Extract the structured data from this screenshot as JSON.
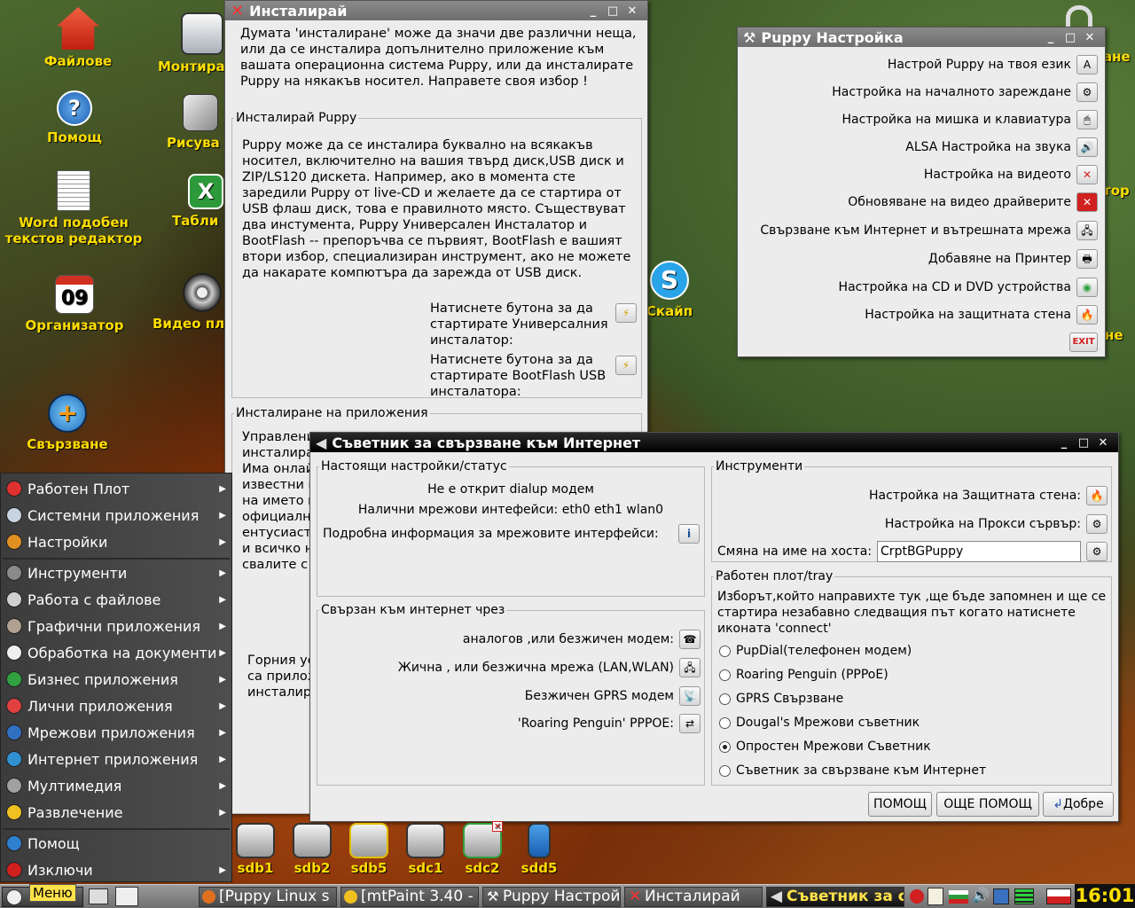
{
  "desktop_icons": [
    {
      "label": "Файлове",
      "color": "#e0402a"
    },
    {
      "label": "Монтира",
      "color": "#dfe6ee"
    },
    {
      "label": "Помощ",
      "color": "#2f7ed8"
    },
    {
      "label": "Рисува",
      "color": "#8a8f99"
    },
    {
      "label": "Word подобен текстов редактор",
      "color": "#f4f4f4"
    },
    {
      "label": "Табли",
      "color": "#2c9a3a"
    },
    {
      "label": "Организатор",
      "color": "#e8e8e8"
    },
    {
      "label": "Видео пл",
      "color": "#bdbdbd"
    },
    {
      "label": "Свързване",
      "color": "#2f9ae0"
    },
    {
      "label": "Скайп",
      "color": "#2aa4e8"
    },
    {
      "label": "ане"
    },
    {
      "label": "тор"
    },
    {
      "label": "не"
    }
  ],
  "installer": {
    "title": "Инсталирай",
    "intro": "Думата 'инсталиране' може да значи две различни неща, или да се инсталира допълнително приложение към вашата операционна система Puppy, или да инсталирате Puppy на някакъв носител. Направете своя избор !",
    "puppy_legend": "Инсталирай Puppy",
    "puppy_text": "Puppy може да се инсталира буквално на всякакъв носител, включително на вашия твърд диск,USB диск и ZIP/LS120 дискета. Например, ако в момента сте заредили Puppy от live-CD и  желаете да се стартира от USB флаш диск, това е правилното място. Съществуват два инстумента, Puppy Универсален Инсталатор и BootFlash -- препоръчва се първият, BootFlash е вашият втори избор, специализиран инструмент, ако не можете да накарате компютъра да зарежда от USB диск.",
    "universal_label": "Натиснете бутона за да стартирате Универсалния инсталатор:",
    "bootflash_label": "Натиснете бутона за да стартирате BootFlash USB инсталатора:",
    "apps_legend": "Инсталиране на приложения",
    "apps_lines": [
      "Управлени",
      "инсталира",
      "Има онлай",
      "известни п",
      "на името н",
      "официално",
      "ентусиасти",
      "и всичко н",
      "свалите с"
    ],
    "bottom_lines": [
      "Горния уе",
      "са прилож",
      "инсталир"
    ]
  },
  "settings": {
    "title": "Puppy Настройка",
    "items": [
      {
        "label": "Настрой Puppy на твоя език",
        "icon": "A"
      },
      {
        "label": "Настройка на началното зареждане",
        "icon": "⚙"
      },
      {
        "label": "Настройка на мишка и клавиатура",
        "icon": "🖱"
      },
      {
        "label": "ALSA Настройка на звука",
        "icon": "🔊"
      },
      {
        "label": "Настройка на видеото",
        "icon": "✕"
      },
      {
        "label": "Обновяване на видео драйверите",
        "icon": "✕"
      },
      {
        "label": "Свързване към Интернет и вътрешната мрежа",
        "icon": "🖧"
      },
      {
        "label": "Добавяне на Принтер",
        "icon": "🖶"
      },
      {
        "label": "Настройка на CD и DVD устройства",
        "icon": "◉"
      },
      {
        "label": "Настройка на защитната стена",
        "icon": "🔥"
      }
    ],
    "exit_label": "EXIT"
  },
  "wizard": {
    "title": "Съветник за свързване към Интернет",
    "status_legend": "Настоящи настройки/статус",
    "status_line1": "Не е открит dialup модем",
    "status_line2": "Налични мрежови интефейси: eth0 eth1 wlan0",
    "status_detail": "Подробна информация за мрежовите интерфейси:",
    "connect_legend": "Свързан към интернет чрез",
    "connect_items": [
      {
        "label": "аналогов ,или безжичен модем:",
        "icon": "☎"
      },
      {
        "label": "Жична , или безжична мрежа (LAN,WLAN)",
        "icon": "🖧"
      },
      {
        "label": "Безжичен GPRS модем",
        "icon": "📡"
      },
      {
        "label": "'Roaring Penguin' PPPOE:",
        "icon": "⇄"
      }
    ],
    "tools_legend": "Инструменти",
    "tool_firewall": "Настройка на Защитната стена:",
    "tool_proxy": "Настройка на Прокси сървър:",
    "tool_hostname": "Смяна на име на хоста:",
    "hostname_value": "CrptBGPuppy",
    "tray_legend": "Работен плот/tray",
    "tray_text": "Изборът,който направихте тук ,ще бъде запомнен и ще се стартира незабавно следващия път когато натиснете иконата 'connect'",
    "radio_options": [
      "PupDial(телефонен модем)",
      "Roaring Penguin (PPPoE)",
      "GPRS Свързване",
      "Dougal's Мрежови съветник",
      "Опростен Мрежови Съветник",
      "Съветник за свързване към Интернет"
    ],
    "selected_option": "Опростен Мрежови Съветник",
    "help_button": "ПОМОЩ",
    "more_help_button": "ОЩЕ ПОМОЩ",
    "ok_button": "Добре"
  },
  "start_menu": {
    "items": [
      {
        "label": "Работен Плот",
        "color": "#e03030"
      },
      {
        "label": "Системни приложения",
        "color": "#c8d4e0"
      },
      {
        "label": "Настройки",
        "color": "#e09020"
      },
      {
        "label": "Инструменти",
        "color": "#8a8a8a"
      },
      {
        "label": "Работа с файлове",
        "color": "#d0d0d0"
      },
      {
        "label": "Графични приложения",
        "color": "#b0a090"
      },
      {
        "label": "Обработка на документи",
        "color": "#f0f0f0"
      },
      {
        "label": "Бизнес приложения",
        "color": "#30a040"
      },
      {
        "label": "Лични приложения",
        "color": "#e04040"
      },
      {
        "label": "Мрежови приложения",
        "color": "#3070c0"
      },
      {
        "label": "Интернет приложения",
        "color": "#3090d0"
      },
      {
        "label": "Мултимедия",
        "color": "#a0a0a0"
      },
      {
        "label": "Развлечение",
        "color": "#f0c020"
      },
      {
        "label": "Помощ",
        "color": "#3080d0"
      },
      {
        "label": "Изключи",
        "color": "#d02020"
      }
    ]
  },
  "drives": [
    "sdb1",
    "sdb2",
    "sdb5",
    "sdc1",
    "sdc2",
    "sdd5"
  ],
  "taskbar": {
    "menu_label": "Меню",
    "tasks": [
      "[Puppy Linux s",
      "[mtPaint 3.40 -",
      "Puppy Настрой",
      "Инсталирай",
      "Съветник за с"
    ],
    "clock": "16:01"
  }
}
